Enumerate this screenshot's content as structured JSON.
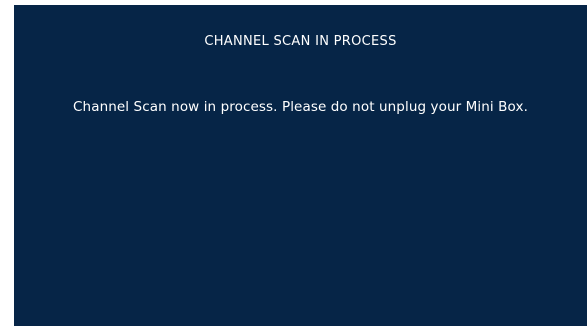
{
  "dialog": {
    "title": "CHANNEL SCAN IN PROCESS",
    "message": "Channel Scan now in process. Please do not unplug your Mini Box."
  },
  "colors": {
    "background": "#062547",
    "text": "#ffffff"
  }
}
